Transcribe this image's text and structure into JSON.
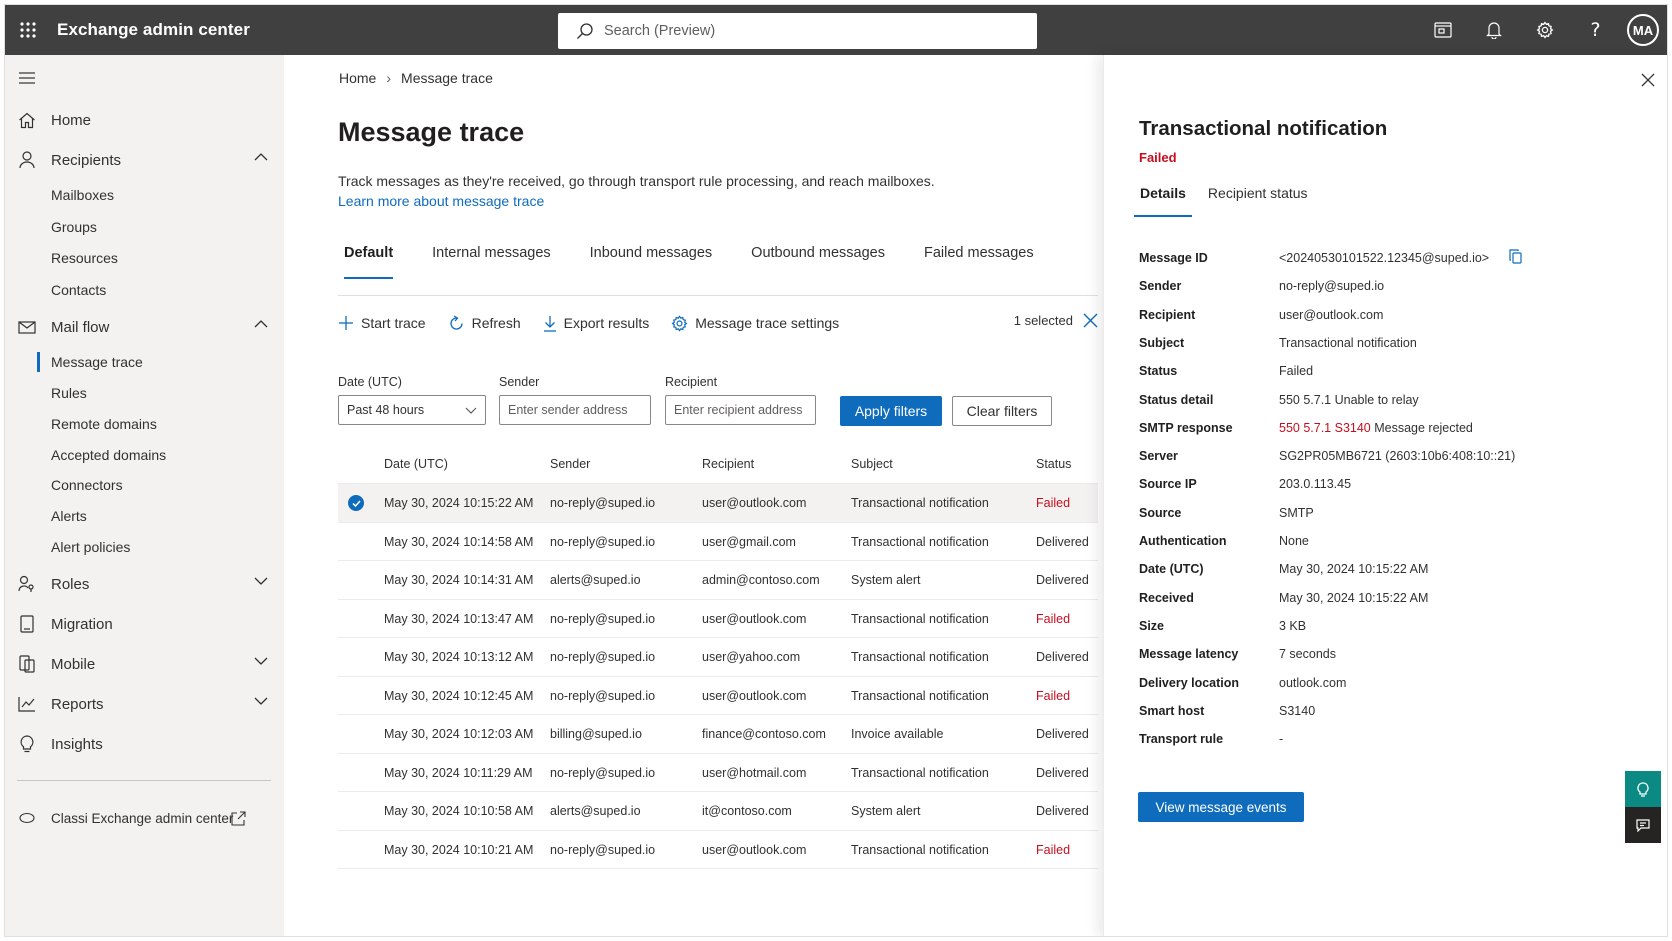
{
  "app": {
    "title": "Exchange admin center"
  },
  "search": {
    "placeholder": "Search (Preview)"
  },
  "user": {
    "initials": "MA"
  },
  "sidebar": {
    "items": [
      {
        "label": "Home"
      },
      {
        "label": "Recipients"
      },
      {
        "label": "Mail flow"
      },
      {
        "label": "Roles"
      },
      {
        "label": "Migration"
      },
      {
        "label": "Mobile"
      },
      {
        "label": "Reports"
      },
      {
        "label": "Insights"
      }
    ],
    "recipients_sub": [
      "Mailboxes",
      "Groups",
      "Resources",
      "Contacts"
    ],
    "mailflow_sub": [
      "Message trace",
      "Rules",
      "Remote domains",
      "Accepted domains",
      "Connectors",
      "Alerts",
      "Alert policies"
    ],
    "classic_link": "Classi Exchange admin center"
  },
  "breadcrumb": {
    "home": "Home",
    "current": "Message trace"
  },
  "page": {
    "title": "Message trace",
    "description": "Track messages as they're received, go through transport rule processing, and reach mailboxes.",
    "learn_more": "Learn more about message trace"
  },
  "tabs": [
    "Default",
    "Internal messages",
    "Inbound messages",
    "Outbound messages",
    "Failed messages"
  ],
  "toolbar": {
    "start_trace": "Start trace",
    "refresh": "Refresh",
    "export": "Export results",
    "settings": "Message trace settings",
    "selected": "1 selected"
  },
  "filters": {
    "date_label": "Date (UTC)",
    "date_value": "Past 48 hours",
    "sender_label": "Sender",
    "sender_placeholder": "Enter sender address",
    "recipient_label": "Recipient",
    "recipient_placeholder": "Enter recipient address",
    "apply": "Apply filters",
    "clear": "Clear filters"
  },
  "table": {
    "columns": [
      "Date (UTC)",
      "Sender",
      "Recipient",
      "Subject",
      "Status"
    ],
    "rows": [
      {
        "date": "May 30, 2024 10:15:22 AM",
        "sender": "no-reply@suped.io",
        "recipient": "user@outlook.com",
        "subject": "Transactional notification",
        "status": "Failed"
      },
      {
        "date": "May 30, 2024 10:14:58 AM",
        "sender": "no-reply@suped.io",
        "recipient": "user@gmail.com",
        "subject": "Transactional notification",
        "status": "Delivered"
      },
      {
        "date": "May 30, 2024 10:14:31 AM",
        "sender": "alerts@suped.io",
        "recipient": "admin@contoso.com",
        "subject": "System alert",
        "status": "Delivered"
      },
      {
        "date": "May 30, 2024 10:13:47 AM",
        "sender": "no-reply@suped.io",
        "recipient": "user@outlook.com",
        "subject": "Transactional notification",
        "status": "Failed"
      },
      {
        "date": "May 30, 2024 10:13:12 AM",
        "sender": "no-reply@suped.io",
        "recipient": "user@yahoo.com",
        "subject": "Transactional notification",
        "status": "Delivered"
      },
      {
        "date": "May 30, 2024 10:12:45 AM",
        "sender": "no-reply@suped.io",
        "recipient": "user@outlook.com",
        "subject": "Transactional notification",
        "status": "Failed"
      },
      {
        "date": "May 30, 2024 10:12:03 AM",
        "sender": "billing@suped.io",
        "recipient": "finance@contoso.com",
        "subject": "Invoice available",
        "status": "Delivered"
      },
      {
        "date": "May 30, 2024 10:11:29 AM",
        "sender": "no-reply@suped.io",
        "recipient": "user@hotmail.com",
        "subject": "Transactional notification",
        "status": "Delivered"
      },
      {
        "date": "May 30, 2024 10:10:58 AM",
        "sender": "alerts@suped.io",
        "recipient": "it@contoso.com",
        "subject": "System alert",
        "status": "Delivered"
      },
      {
        "date": "May 30, 2024 10:10:21 AM",
        "sender": "no-reply@suped.io",
        "recipient": "user@outlook.com",
        "subject": "Transactional notification",
        "status": "Failed"
      }
    ]
  },
  "panel": {
    "title": "Transactional notification",
    "status": "Failed",
    "tabs": [
      "Details",
      "Recipient status"
    ],
    "fields": [
      {
        "label": "Message ID",
        "value": "<20240530101522.12345@suped.io>"
      },
      {
        "label": "Sender",
        "value": "no-reply@suped.io"
      },
      {
        "label": "Recipient",
        "value": "user@outlook.com"
      },
      {
        "label": "Subject",
        "value": "Transactional notification"
      },
      {
        "label": "Status",
        "value": "Failed"
      },
      {
        "label": "Status detail",
        "value": "550 5.7.1 Unable to relay"
      },
      {
        "label": "SMTP response",
        "value_red": "550 5.7.1 S3140",
        "value_rest": " Message rejected"
      },
      {
        "label": "Server",
        "value": "SG2PR05MB6721 (2603:10b6:408:10::21)"
      },
      {
        "label": "Source IP",
        "value": "203.0.113.45"
      },
      {
        "label": "Source",
        "value": "SMTP"
      },
      {
        "label": "Authentication",
        "value": "None"
      },
      {
        "label": "Date (UTC)",
        "value": "May 30, 2024 10:15:22 AM"
      },
      {
        "label": "Received",
        "value": "May 30, 2024 10:15:22 AM"
      },
      {
        "label": "Size",
        "value": "3 KB"
      },
      {
        "label": "Message latency",
        "value": "7 seconds"
      },
      {
        "label": "Delivery location",
        "value": "outlook.com"
      },
      {
        "label": "Smart host",
        "value": "S3140"
      },
      {
        "label": "Transport rule",
        "value": "-"
      }
    ],
    "view_events": "View message events"
  },
  "colors": {
    "accent": "#0f6cbd",
    "failed": "#c50f1f",
    "topbar": "#404040",
    "sidebar": "#f3f2f1"
  }
}
